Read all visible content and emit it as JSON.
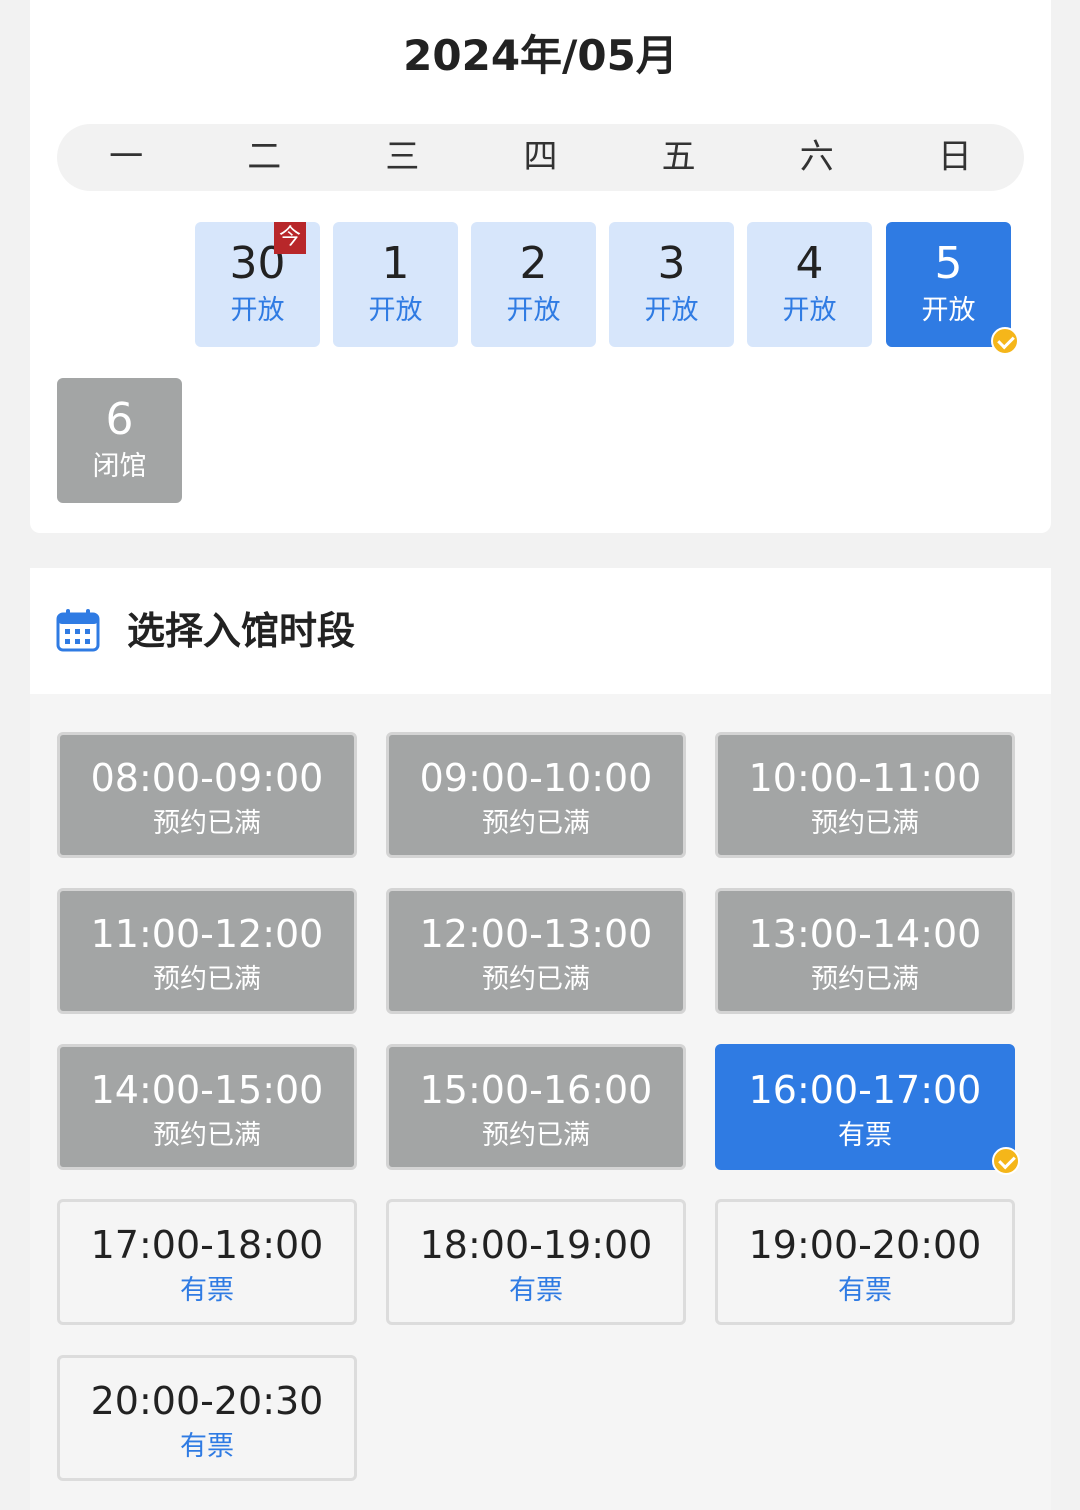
{
  "calendar": {
    "month_title": "2024年/05月",
    "weekdays": [
      "一",
      "二",
      "三",
      "四",
      "五",
      "六",
      "日"
    ],
    "today_tag": "今",
    "days": [
      {
        "num": "30",
        "status": "开放"
      },
      {
        "num": "1",
        "status": "开放"
      },
      {
        "num": "2",
        "status": "开放"
      },
      {
        "num": "3",
        "status": "开放"
      },
      {
        "num": "4",
        "status": "开放"
      },
      {
        "num": "5",
        "status": "开放"
      },
      {
        "num": "6",
        "status": "闭馆"
      }
    ]
  },
  "slots_section": {
    "title": "选择入馆时段",
    "icon": "calendar-icon",
    "slots": [
      {
        "time": "08:00-09:00",
        "status": "预约已满"
      },
      {
        "time": "09:00-10:00",
        "status": "预约已满"
      },
      {
        "time": "10:00-11:00",
        "status": "预约已满"
      },
      {
        "time": "11:00-12:00",
        "status": "预约已满"
      },
      {
        "time": "12:00-13:00",
        "status": "预约已满"
      },
      {
        "time": "13:00-14:00",
        "status": "预约已满"
      },
      {
        "time": "14:00-15:00",
        "status": "预约已满"
      },
      {
        "time": "15:00-16:00",
        "status": "预约已满"
      },
      {
        "time": "16:00-17:00",
        "status": "有票"
      },
      {
        "time": "17:00-18:00",
        "status": "有票"
      },
      {
        "time": "18:00-19:00",
        "status": "有票"
      },
      {
        "time": "19:00-20:00",
        "status": "有票"
      },
      {
        "time": "20:00-20:30",
        "status": "有票"
      }
    ]
  },
  "colors": {
    "accent": "#2f7be3",
    "open_day_bg": "#d7e6fb",
    "unavailable_bg": "#a3a5a5",
    "today_tag_bg": "#b8272a",
    "check_badge": "#f5b61a"
  }
}
